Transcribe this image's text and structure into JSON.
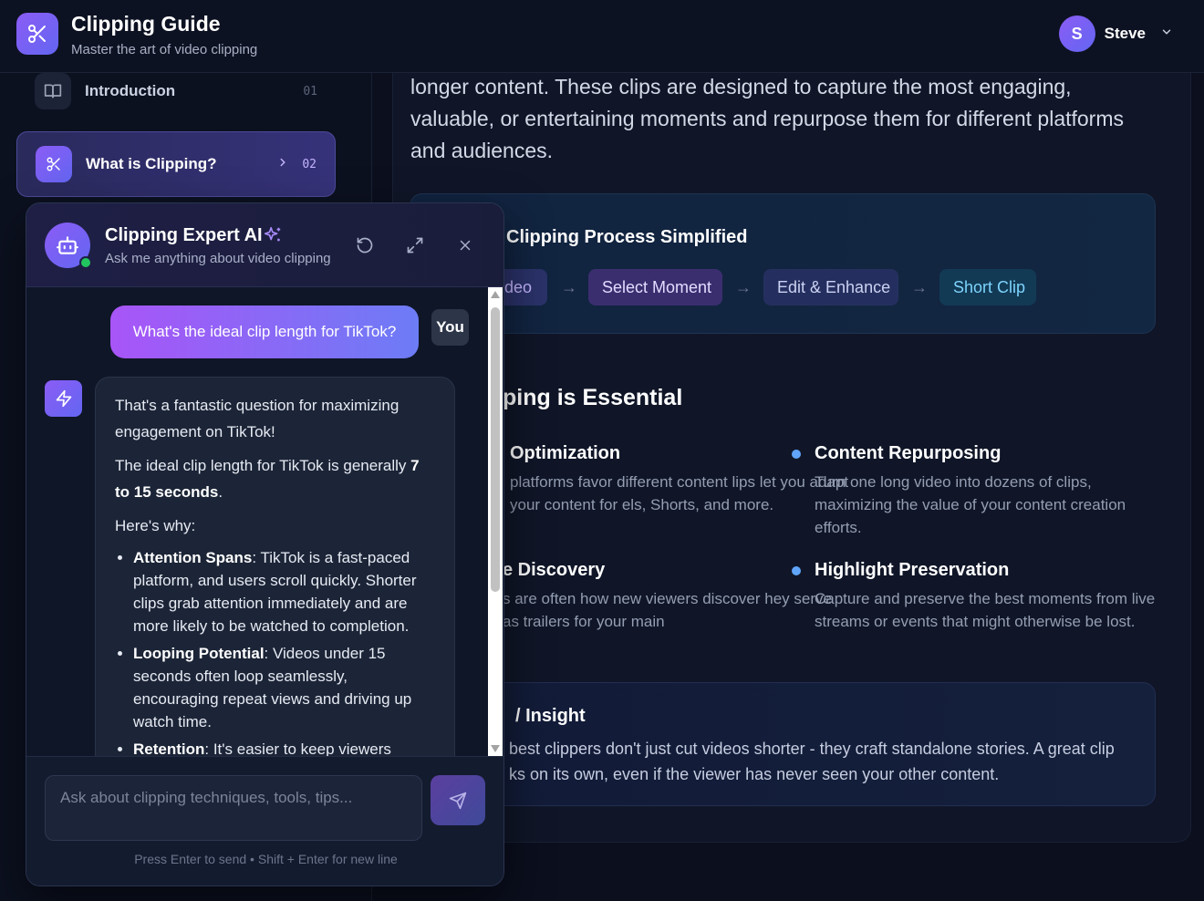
{
  "header": {
    "title": "Clipping Guide",
    "subtitle": "Master the art of video clipping",
    "user": {
      "initial": "S",
      "name": "Steve"
    }
  },
  "sidebar": {
    "items": [
      {
        "label": "Introduction",
        "number": "01",
        "icon": "book-icon"
      },
      {
        "label": "What is Clipping?",
        "number": "02",
        "icon": "scissors-icon",
        "active": true
      }
    ]
  },
  "main": {
    "intro_text": "longer content. These clips are designed to capture the most engaging, valuable, or entertaining moments and repurpose them for different platforms and audiences.",
    "process": {
      "title": "Clipping Process Simplified",
      "steps": [
        "deo",
        "Select Moment",
        "Edit & Enhance",
        "Short Clip"
      ],
      "arrow": "→"
    },
    "essential": {
      "title": "ping is Essential",
      "features": [
        {
          "title": "Optimization",
          "text": "platforms favor different content lips let you adapt your content for els, Shorts, and more."
        },
        {
          "title": "Content Repurposing",
          "text": "Turn one long video into dozens of clips, maximizing the value of your content creation efforts."
        },
        {
          "title": "e Discovery",
          "text": "s are often how new viewers discover hey serve as trailers for your main"
        },
        {
          "title": "Highlight Preservation",
          "text": "Capture and preserve the best moments from live streams or events that might otherwise be lost."
        }
      ]
    },
    "insight": {
      "title": "/ Insight",
      "text": "best clippers don't just cut videos shorter - they craft standalone stories. A great clip ks on its own, even if the viewer has never seen your other content."
    }
  },
  "chat": {
    "title": "Clipping Expert AI",
    "subtitle": "Ask me anything about video clipping",
    "user_message": "What's the ideal clip length for TikTok?",
    "you_label": "You",
    "bot_reply": {
      "p1": "That's a fantastic question for maximizing engagement on TikTok!",
      "p2_pre": "The ideal clip length for TikTok is generally ",
      "p2_bold": "7 to 15 seconds",
      "p2_post": ".",
      "p3": "Here's why:",
      "bullets": [
        {
          "bold": "Attention Spans",
          "text": ": TikTok is a fast-paced platform, and users scroll quickly. Shorter clips grab attention immediately and are more likely to be watched to completion."
        },
        {
          "bold": "Looping Potential",
          "text": ": Videos under 15 seconds often loop seamlessly, encouraging repeat views and driving up watch time."
        },
        {
          "bold": "Retention",
          "text": ": It's easier to keep viewers"
        }
      ]
    },
    "input_placeholder": "Ask about clipping techniques, tools, tips...",
    "hint": "Press Enter to send • Shift + Enter for new line"
  }
}
